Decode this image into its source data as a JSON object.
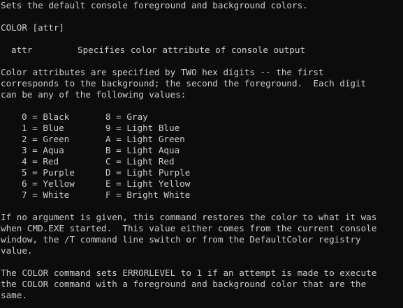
{
  "console": {
    "description": "Sets the default console foreground and background colors.",
    "syntax": "COLOR [attr]",
    "param": {
      "name": "attr",
      "text": "Specifies color attribute of console output"
    },
    "intro": [
      "Color attributes are specified by TWO hex digits -- the first",
      "corresponds to the background; the second the foreground.  Each digit",
      "can be any of the following values:"
    ],
    "colors": [
      {
        "left": "0 = Black",
        "right": "8 = Gray"
      },
      {
        "left": "1 = Blue",
        "right": "9 = Light Blue"
      },
      {
        "left": "2 = Green",
        "right": "A = Light Green"
      },
      {
        "left": "3 = Aqua",
        "right": "B = Light Aqua"
      },
      {
        "left": "4 = Red",
        "right": "C = Light Red"
      },
      {
        "left": "5 = Purple",
        "right": "D = Light Purple"
      },
      {
        "left": "6 = Yellow",
        "right": "E = Light Yellow"
      },
      {
        "left": "7 = White",
        "right": "F = Bright White"
      }
    ],
    "noarg": [
      "If no argument is given, this command restores the color to what it was",
      "when CMD.EXE started.  This value either comes from the current console",
      "window, the /T command line switch or from the DefaultColor registry",
      "value."
    ],
    "errorlevel": [
      "The COLOR command sets ERRORLEVEL to 1 if an attempt is made to execute",
      "the COLOR command with a foreground and background color that are the",
      "same."
    ],
    "theme": {
      "background": "#0c0c0c",
      "foreground": "#cccccc"
    }
  }
}
